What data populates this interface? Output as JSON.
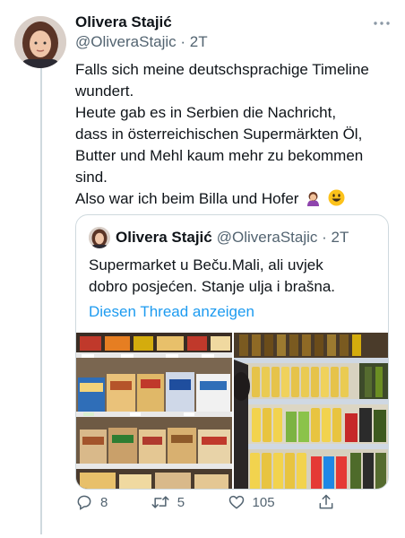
{
  "tweet": {
    "author_name": "Olivera Stajić",
    "handle": "@OliveraStajic",
    "timestamp": "2T",
    "more_icon": "more-icon",
    "lines": [
      "Falls sich meine deutschsprachige Timeline",
      "wundert.",
      "Heute gab es in Serbien die Nachricht,",
      "dass in österreichischen Supermärkten Öl,",
      "Butter und Mehl kaum mehr zu bekommen",
      "sind.",
      "Also war ich beim Billa und Hofer"
    ],
    "emojis": [
      "woman-facepalming-emoji",
      "grinning-face-emoji"
    ]
  },
  "quoted_tweet": {
    "author_name": "Olivera Stajić",
    "handle": "@OliveraStajic",
    "timestamp": "2T",
    "lines": [
      "Supermarket u Beču.Mali, ali uvjek",
      "dobro posjećen. Stanje ulja i brašna."
    ],
    "thread_link": "Diesen Thread anzeigen",
    "photos": [
      "flour-shelf-photo",
      "oil-shelf-photo"
    ]
  },
  "actions": {
    "reply_count": "8",
    "retweet_count": "5",
    "like_count": "105",
    "icons": [
      "reply-icon",
      "retweet-icon",
      "like-icon",
      "share-icon"
    ]
  },
  "colors": {
    "text": "#0f1419",
    "secondary": "#536471",
    "link": "#1d9bf0",
    "border": "#cfd9de"
  }
}
